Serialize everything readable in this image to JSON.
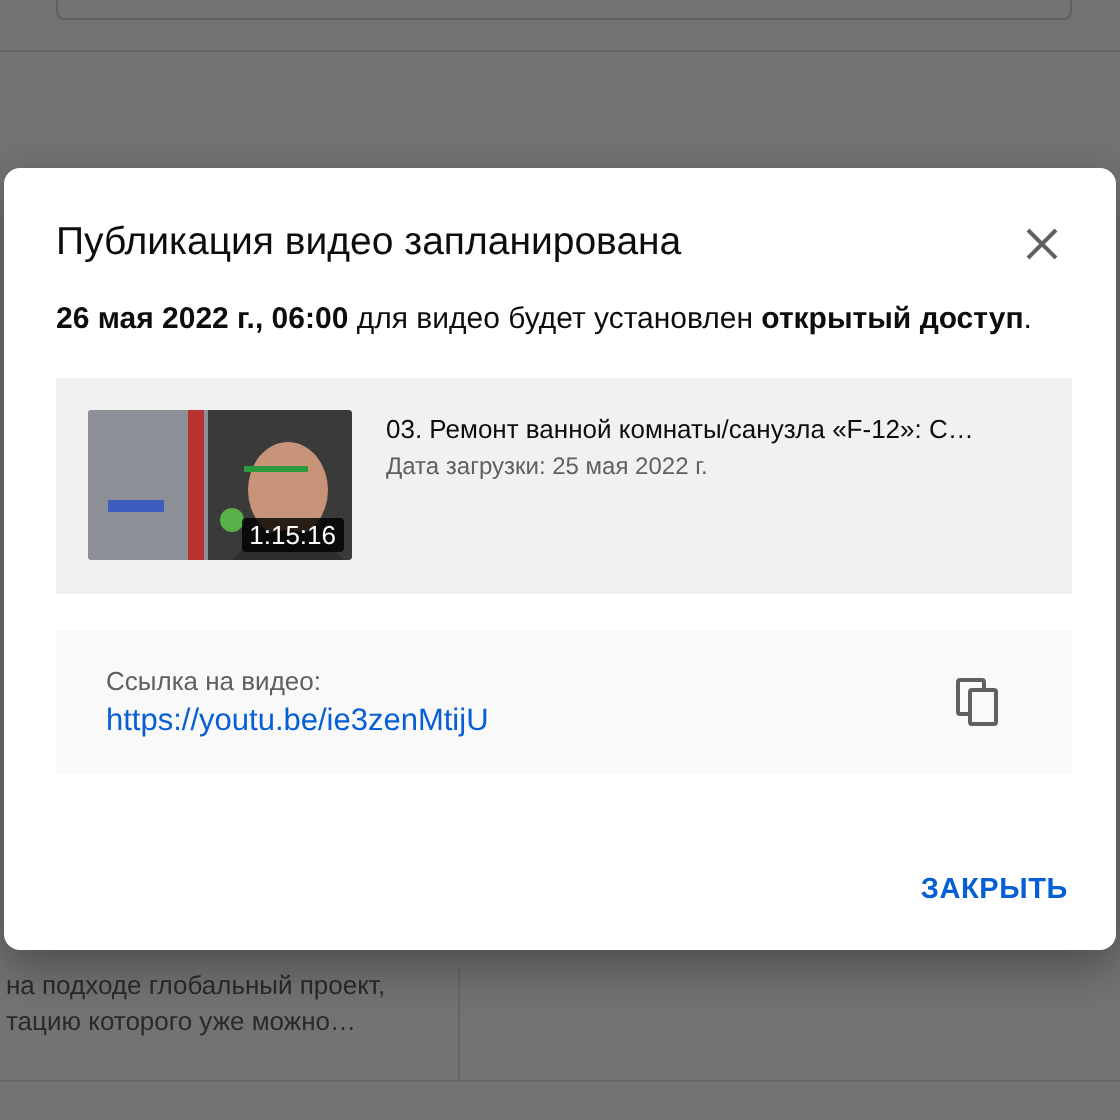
{
  "background": {
    "lines": [
      "на подходе глобальный проект,",
      "тацию которого уже можно…"
    ]
  },
  "dialog": {
    "title": "Публикация видео запланирована",
    "message": "**26 мая 2022 г., 06:00** для видео будет установлен **открытый доступ**.",
    "video": {
      "kind": "picture",
      "duration": "1:15:16",
      "title": "03. Ремонт ванной комнаты/санузла «F-12»: С…",
      "uploaded": "Дата загрузки: 25 мая 2022 г."
    },
    "link": {
      "label": "Ссылка на видео:",
      "url": "https://youtu.be/ie3zenMtijU"
    },
    "buttons": [
      "ЗАКРЫТЬ"
    ]
  }
}
